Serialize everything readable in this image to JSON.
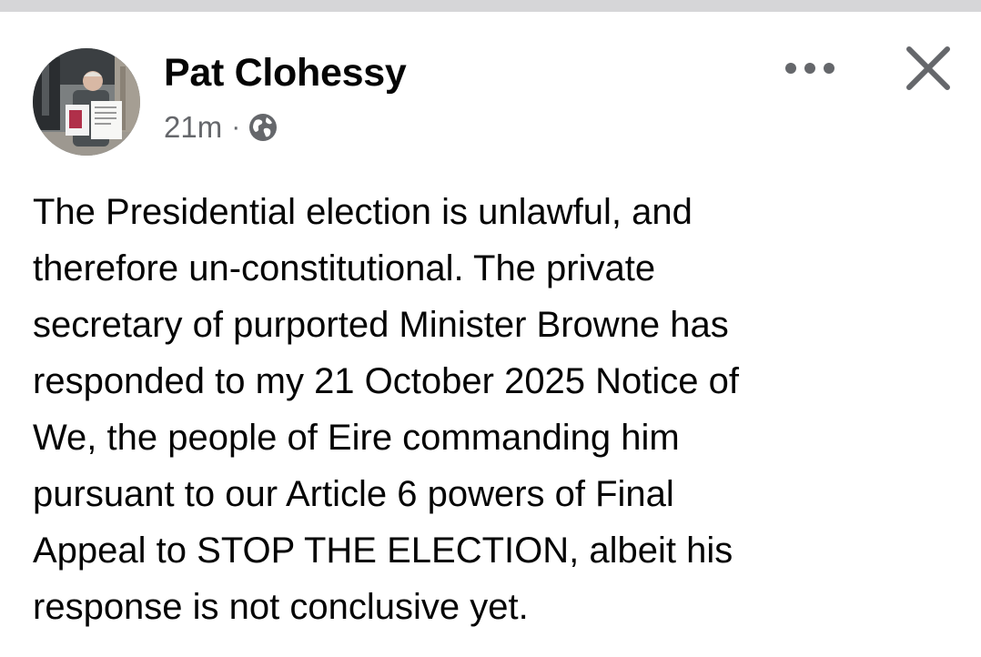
{
  "post": {
    "author": "Pat Clohessy",
    "timestamp": "21m",
    "separator": "·",
    "audience_icon": "globe-icon",
    "more_icon": "more-horizontal-icon",
    "close_icon": "close-icon",
    "avatar_alt": "profile-photo",
    "text_lines": [
      "The Presidential election is unlawful, and",
      "therefore un-constitutional. The private",
      "secretary of purported Minister Browne has",
      "responded to my 21 October 2025 Notice of",
      "We, the people of Eire commanding him",
      "pursuant to our Article 6 powers of Final",
      "Appeal to STOP THE ELECTION, albeit his",
      "response is not conclusive yet."
    ]
  },
  "colors": {
    "top_bar": "#d6d6d8",
    "name": "#050505",
    "meta": "#65676b",
    "icon": "#65676b"
  }
}
